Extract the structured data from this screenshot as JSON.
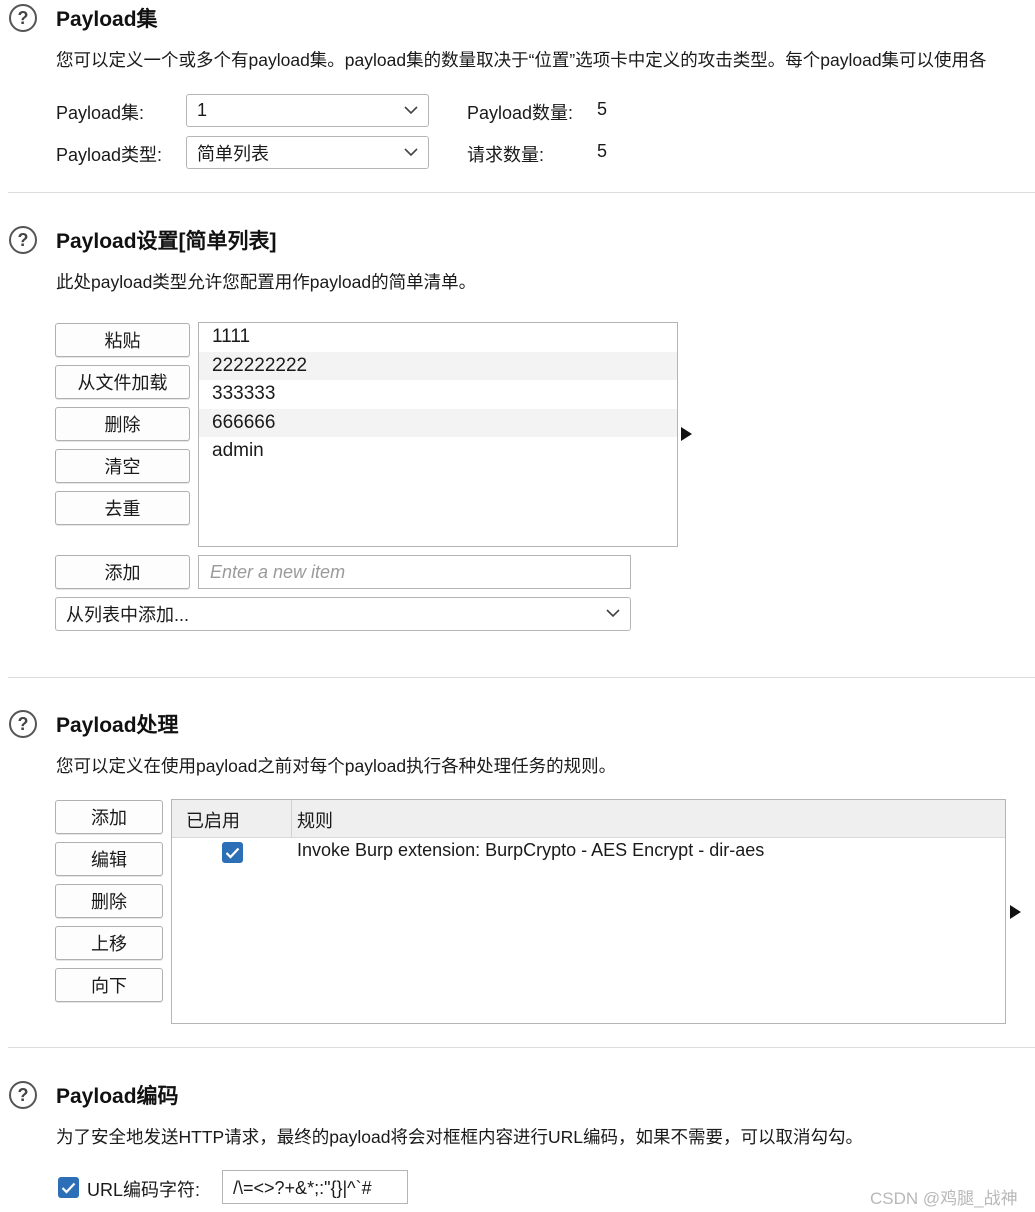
{
  "payload_sets": {
    "title": "Payload集",
    "description": "您可以定义一个或多个有payload集。payload集的数量取决于“位置”选项卡中定义的攻击类型。每个payload集可以使用各",
    "set_label": "Payload集:",
    "set_value": "1",
    "type_label": "Payload类型:",
    "type_value": "简单列表",
    "count_label": "Payload数量:",
    "count_value": "5",
    "request_label": "请求数量:",
    "request_value": "5"
  },
  "payload_settings": {
    "title": "Payload设置[简单列表]",
    "description": "此处payload类型允许您配置用作payload的简单清单。",
    "buttons": [
      "粘贴",
      "从文件加载",
      "删除",
      "清空",
      "去重"
    ],
    "items": [
      "1111",
      "222222222",
      "333333",
      "666666",
      "admin"
    ],
    "add_button": "添加",
    "add_placeholder": "Enter a new item",
    "add_from_list": "从列表中添加..."
  },
  "payload_processing": {
    "title": "Payload处理",
    "description": "您可以定义在使用payload之前对每个payload执行各种处理任务的规则。",
    "buttons": [
      "添加",
      "编辑",
      "删除",
      "上移",
      "向下"
    ],
    "columns": [
      "已启用",
      "规则"
    ],
    "rules": [
      {
        "enabled": true,
        "rule": "Invoke Burp extension: BurpCrypto - AES Encrypt - dir-aes"
      }
    ]
  },
  "payload_encoding": {
    "title": "Payload编码",
    "description": "为了安全地发送HTTP请求，最终的payload将会对框框内容进行URL编码，如果不需要，可以取消勾勾。",
    "checkbox_label": "URL编码字符:",
    "checked": true,
    "chars": "/\\=<>?+&*;:\"{}|^`#"
  },
  "watermark": "CSDN @鸡腿_战神",
  "colors": {
    "accent": "#2c6fb7"
  }
}
